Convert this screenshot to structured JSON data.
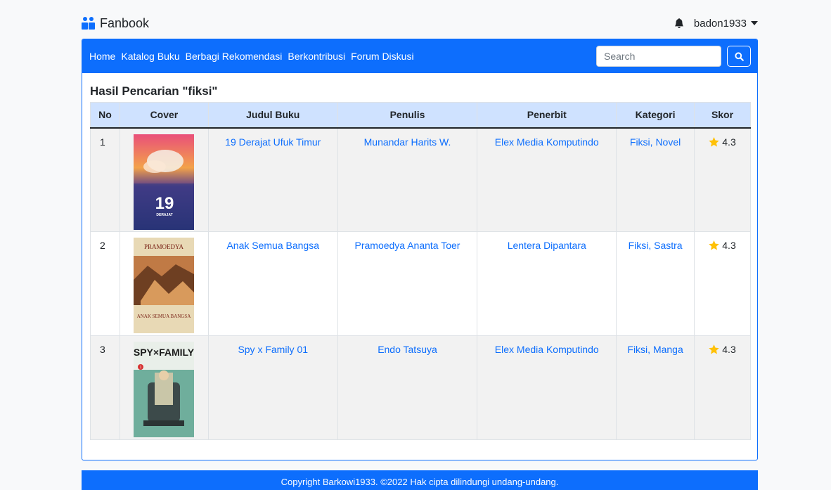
{
  "brand": {
    "name": "Fanbook"
  },
  "user": {
    "username": "badon1933"
  },
  "nav": {
    "links": [
      "Home",
      "Katalog Buku",
      "Berbagi Rekomendasi",
      "Berkontribusi",
      "Forum Diskusi"
    ],
    "search_placeholder": "Search"
  },
  "results": {
    "title": "Hasil Pencarian \"fiksi\"",
    "columns": [
      "No",
      "Cover",
      "Judul Buku",
      "Penulis",
      "Penerbit",
      "Kategori",
      "Skor"
    ],
    "rows": [
      {
        "no": "1",
        "title": "19 Derajat Ufuk Timur",
        "author": "Munandar Harits W.",
        "publisher": "Elex Media Komputindo",
        "category": "Fiksi, Novel",
        "score": "4.3",
        "cover_text": "19",
        "cover_subtext": "DERAJAT"
      },
      {
        "no": "2",
        "title": "Anak Semua Bangsa",
        "author": "Pramoedya Ananta Toer",
        "publisher": "Lentera Dipantara",
        "category": "Fiksi, Sastra",
        "score": "4.3",
        "cover_text": "PRAMOEDYA",
        "cover_subtext": "ANAK SEMUA BANGSA"
      },
      {
        "no": "3",
        "title": "Spy x Family 01",
        "author": "Endo Tatsuya",
        "publisher": "Elex Media Komputindo",
        "category": "Fiksi, Manga",
        "score": "4.3",
        "cover_text": "SPY×FAMILY",
        "cover_subtext": "1"
      }
    ]
  },
  "footer": {
    "text": "Copyright Barkowi1933. ©2022 Hak cipta dilindungi undang-undang."
  },
  "colors": {
    "primary": "#0d6efd",
    "header_row": "#cfe2ff",
    "star": "#ffc107"
  }
}
